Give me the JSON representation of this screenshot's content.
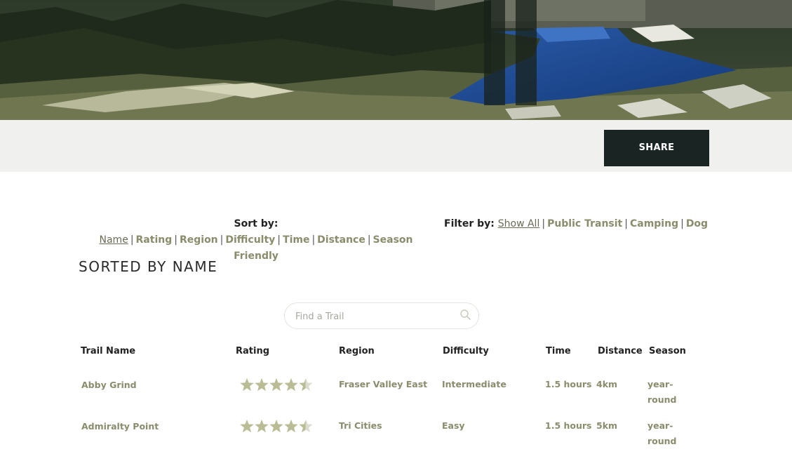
{
  "share": {
    "label": "SHARE"
  },
  "sort": {
    "label": "Sort by:",
    "options": [
      "Name",
      "Rating",
      "Region",
      "Difficulty",
      "Time",
      "Distance",
      "Season Friendly"
    ],
    "active": "Name"
  },
  "filter": {
    "label": "Filter by:",
    "options": [
      "Show All",
      "Public Transit",
      "Camping",
      "Dog"
    ],
    "active": "Show All"
  },
  "heading": "SORTED BY NAME",
  "search": {
    "placeholder": "Find a Trail",
    "icon": "search-icon"
  },
  "table": {
    "headers": [
      "Trail Name",
      "Rating",
      "Region",
      "Difficulty",
      "Time",
      "Distance",
      "Season"
    ],
    "rows": [
      {
        "name": "Abby Grind",
        "rating": 4.5,
        "region": "Fraser Valley East",
        "difficulty": "Intermediate",
        "time": "1.5 hours",
        "distance": "4km",
        "season": "year-round"
      },
      {
        "name": "Admiralty Point",
        "rating": 4.5,
        "region": "Tri Cities",
        "difficulty": "Easy",
        "time": "1.5 hours",
        "distance": "5km",
        "season": "year-round"
      }
    ]
  },
  "colors": {
    "accent": "#8a8c6c",
    "dark": "#1a2422",
    "bar": "#f0f0ee",
    "star_filled": "#b9bc94",
    "star_empty": "#dcdcd0"
  }
}
